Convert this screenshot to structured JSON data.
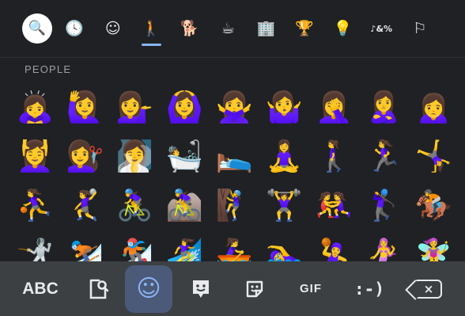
{
  "colors": {
    "background": "#202124",
    "bottom_bar": "#3c4043",
    "accent": "#8ab4f8",
    "active_key": "#4a5a78",
    "section_label": "#9aa0a6"
  },
  "categories": [
    {
      "name": "search-icon",
      "glyph": "🔍"
    },
    {
      "name": "recent-icon",
      "glyph": "🕓"
    },
    {
      "name": "smileys-icon",
      "glyph": "☺"
    },
    {
      "name": "people-icon",
      "glyph": "🚶"
    },
    {
      "name": "animals-nature-icon",
      "glyph": "🐕"
    },
    {
      "name": "food-drink-icon",
      "glyph": "☕"
    },
    {
      "name": "travel-places-icon",
      "glyph": "🏢"
    },
    {
      "name": "activities-icon",
      "glyph": "🏆"
    },
    {
      "name": "objects-icon",
      "glyph": "💡"
    },
    {
      "name": "symbols-icon",
      "glyph": "♪&%"
    },
    {
      "name": "flags-icon",
      "glyph": "⚐"
    }
  ],
  "active_category": "people-icon",
  "section_label": "PEOPLE",
  "emoji_rows": [
    [
      "🙇‍♀️",
      "🙋‍♀️",
      "💁‍♀️",
      "🙆‍♀️",
      "🙅‍♀️",
      "🤷‍♀️",
      "🤦‍♀️",
      "🙎‍♀️",
      "🙍‍♀️"
    ],
    [
      "💆‍♀️",
      "💇‍♀️",
      "🧖‍♀️",
      "🛀",
      "🛌",
      "🧘‍♀️",
      "🚶‍♀️",
      "🏃‍♀️",
      "🤸‍♀️"
    ],
    [
      "⛹️‍♀️",
      "🤾‍♀️",
      "🚴‍♀️",
      "🚵‍♀️",
      "🧗‍♀️",
      "🏋️‍♀️",
      "🤼‍♀️",
      "🏌️‍♀️",
      "🏇"
    ],
    [
      "🤺",
      "⛷️",
      "🏂",
      "🏄‍♀️",
      "🚣‍♀️",
      "🏊‍♀️",
      "🤽‍♀️",
      "🧜‍♀️",
      "🧚‍♀️"
    ]
  ],
  "bottom_bar": {
    "abc_label": "ABC",
    "sticker_search_icon": "sticker-search-icon",
    "emoji_icon": "☺",
    "bitmoji_icon": "bitmoji-icon",
    "sticker_icon": "sticker-icon",
    "gif_label": "GIF",
    "emoticon_label": ":-)",
    "backspace_x": "×"
  }
}
